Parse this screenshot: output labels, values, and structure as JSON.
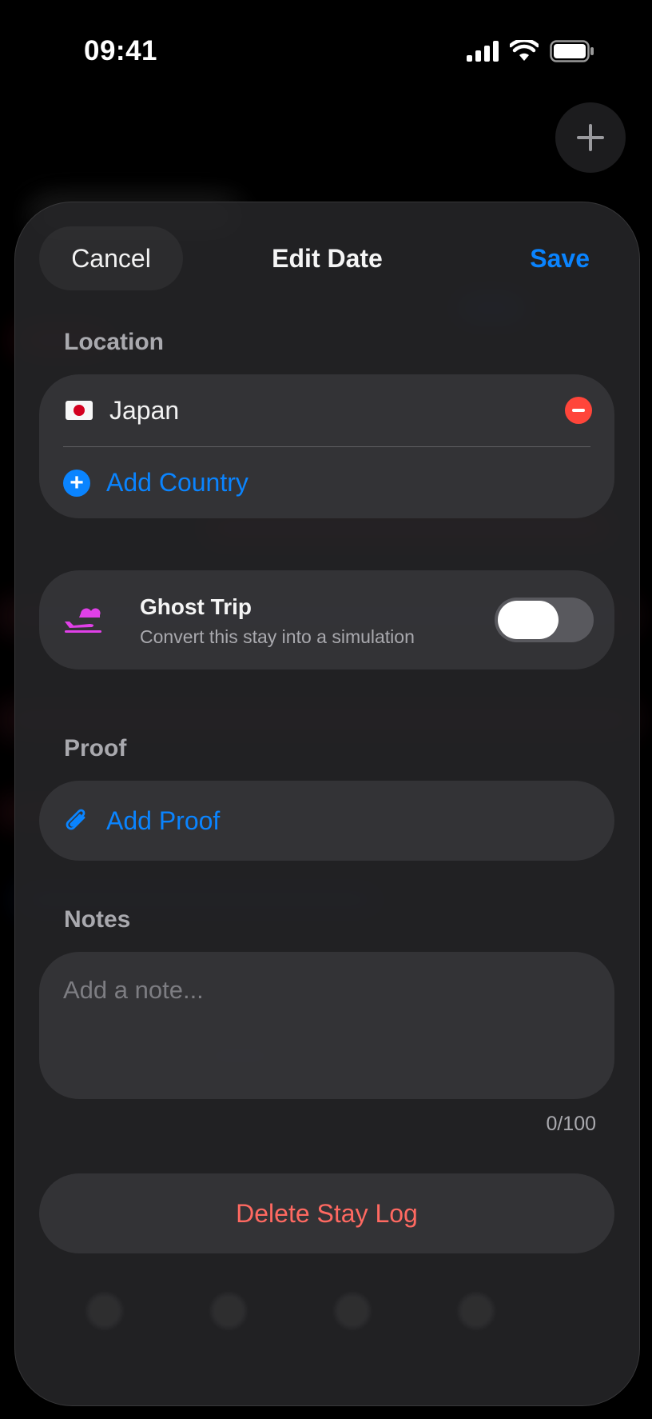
{
  "status_bar": {
    "time": "09:41"
  },
  "header": {
    "plus_icon": "plus-icon"
  },
  "sheet": {
    "cancel_label": "Cancel",
    "title": "Edit Date",
    "save_label": "Save",
    "location": {
      "label": "Location",
      "country": "Japan",
      "add_country_label": "Add Country"
    },
    "ghost_trip": {
      "title": "Ghost Trip",
      "subtitle": "Convert this stay into a simulation",
      "enabled": false
    },
    "proof": {
      "label": "Proof",
      "add_proof_label": "Add Proof"
    },
    "notes": {
      "label": "Notes",
      "placeholder": "Add a note...",
      "counter": "0/100"
    },
    "delete_label": "Delete Stay Log"
  },
  "colors": {
    "accent": "#0a84ff",
    "destructive": "#ff6961",
    "ghost": "#e040e8"
  }
}
